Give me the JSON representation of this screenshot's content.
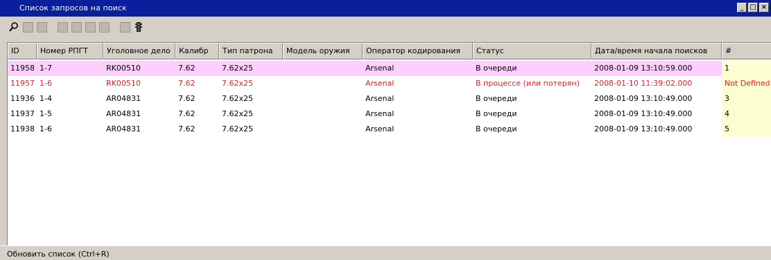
{
  "window": {
    "title": "Список запросов на поиск",
    "controls": [
      "_",
      "□",
      "×"
    ]
  },
  "toolbar": {
    "buttons": [
      {
        "icon": "search-icon"
      },
      {
        "icon": "search-filter-icon"
      },
      {
        "icon": "search-filter-2-icon"
      },
      {
        "icon": "search-add-icon"
      },
      {
        "icon": "search-remove-icon"
      },
      {
        "icon": "grid-icon"
      },
      {
        "icon": "grid-2-icon"
      },
      {
        "icon": "export-icon"
      },
      {
        "icon": "traffic-light-icon"
      }
    ]
  },
  "table": {
    "columns": [
      "ID",
      "Номер РПГТ",
      "Уголовное дело",
      "Калибр",
      "Тип патрона",
      "Модель оружия",
      "Оператор кодирования",
      "Статус",
      "Дата/время начала поисков",
      "#"
    ],
    "rows": [
      {
        "id": "11958",
        "rpgt": "1-7",
        "case": "RK00510",
        "caliber": "7.62",
        "cartridge": "7.62x25",
        "weapon": "",
        "operator": "Arsenal",
        "status": "В очереди",
        "datetime": "2008-01-09 13:10:59.000",
        "hash": "1",
        "state": "selected"
      },
      {
        "id": "11957",
        "rpgt": "1-6",
        "case": "RK00510",
        "caliber": "7.62",
        "cartridge": "7.62x25",
        "weapon": "",
        "operator": "Arsenal",
        "status": "В процессе (или потерян)",
        "datetime": "2008-01-10 11:39:02.000",
        "hash": "Not Defined",
        "state": "error"
      },
      {
        "id": "11936",
        "rpgt": "1-4",
        "case": "AR04831",
        "caliber": "7.62",
        "cartridge": "7.62x25",
        "weapon": "",
        "operator": "Arsenal",
        "status": "В очереди",
        "datetime": "2008-01-09 13:10:49.000",
        "hash": "3",
        "state": "normal"
      },
      {
        "id": "11937",
        "rpgt": "1-5",
        "case": "AR04831",
        "caliber": "7.62",
        "cartridge": "7.62x25",
        "weapon": "",
        "operator": "Arsenal",
        "status": "В очереди",
        "datetime": "2008-01-09 13:10:49.000",
        "hash": "4",
        "state": "normal"
      },
      {
        "id": "11938",
        "rpgt": "1-6",
        "case": "AR04831",
        "caliber": "7.62",
        "cartridge": "7.62x25",
        "weapon": "",
        "operator": "Arsenal",
        "status": "В очереди",
        "datetime": "2008-01-09 13:10:49.000",
        "hash": "5",
        "state": "normal"
      }
    ]
  },
  "statusbar": {
    "text": "Обновить список (Ctrl+R)"
  },
  "colors": {
    "titlebar": "#0a1f9c",
    "selected_row": "#fccffc",
    "error_text": "#e8202a",
    "hash_cell": "#fdfdd2"
  }
}
